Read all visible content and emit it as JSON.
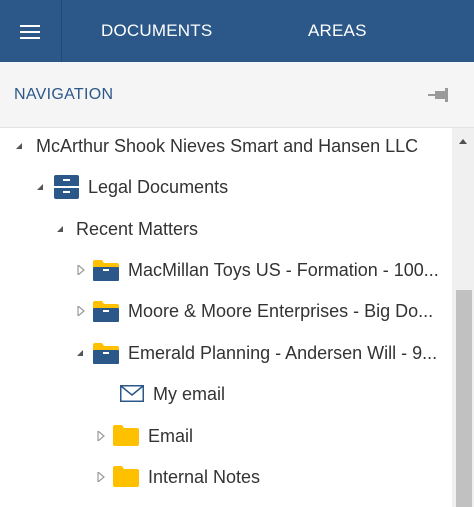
{
  "topbar": {
    "tabs": [
      {
        "label": "DOCUMENTS"
      },
      {
        "label": "AREAS"
      }
    ]
  },
  "navigation": {
    "title": "NAVIGATION"
  },
  "tree": {
    "items": [
      {
        "label": "McArthur Shook Nieves Smart and Hansen LLC",
        "icon": "none",
        "expanded": true
      },
      {
        "label": "Legal Documents",
        "icon": "cabinet-icon",
        "expanded": true
      },
      {
        "label": "Recent Matters",
        "icon": "none",
        "expanded": true
      },
      {
        "label": "MacMillan Toys US - Formation - 100...",
        "icon": "matter-folder-icon",
        "expanded": false
      },
      {
        "label": "Moore & Moore Enterprises - Big Do...",
        "icon": "matter-folder-icon",
        "expanded": false
      },
      {
        "label": "Emerald Planning - Andersen Will - 9...",
        "icon": "matter-folder-icon",
        "expanded": true
      },
      {
        "label": "My email",
        "icon": "envelope-icon",
        "expanded": null
      },
      {
        "label": "Email",
        "icon": "folder-icon",
        "expanded": false
      },
      {
        "label": "Internal Notes",
        "icon": "folder-icon",
        "expanded": false
      }
    ]
  },
  "colors": {
    "brand": "#2b5888",
    "folder": "#ffc000",
    "text": "#333333"
  }
}
